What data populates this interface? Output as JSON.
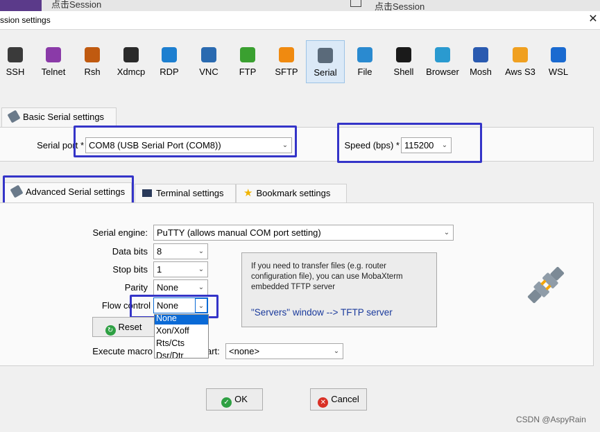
{
  "background": {
    "left_tab_label": "点击Session",
    "right_tab_label": "点击Session"
  },
  "window": {
    "title": "ssion settings",
    "close_glyph": "✕"
  },
  "toolbar": {
    "items": [
      {
        "label": "SSH",
        "icon": "key-icon",
        "color": "#3a3a3a"
      },
      {
        "label": "Telnet",
        "icon": "telnet-icon",
        "color": "#8a3aa8"
      },
      {
        "label": "Rsh",
        "icon": "rsh-icon",
        "color": "#c05a10"
      },
      {
        "label": "Xdmcp",
        "icon": "xdmcp-icon",
        "color": "#2a2a2a"
      },
      {
        "label": "RDP",
        "icon": "rdp-icon",
        "color": "#1d7fd0"
      },
      {
        "label": "VNC",
        "icon": "vnc-icon",
        "color": "#2a6ab0"
      },
      {
        "label": "FTP",
        "icon": "ftp-icon",
        "color": "#3aa030"
      },
      {
        "label": "SFTP",
        "icon": "sftp-icon",
        "color": "#f08a10"
      },
      {
        "label": "Serial",
        "icon": "serial-plug-icon",
        "color": "#5a6a7a",
        "selected": true
      },
      {
        "label": "File",
        "icon": "file-icon",
        "color": "#2a8ad0"
      },
      {
        "label": "Shell",
        "icon": "shell-icon",
        "color": "#1a1a1a"
      },
      {
        "label": "Browser",
        "icon": "globe-icon",
        "color": "#2a9ad0"
      },
      {
        "label": "Mosh",
        "icon": "mosh-icon",
        "color": "#2a5ab0"
      },
      {
        "label": "Aws S3",
        "icon": "aws-s3-icon",
        "color": "#f0a020"
      },
      {
        "label": "WSL",
        "icon": "wsl-icon",
        "color": "#1a6ad0"
      }
    ]
  },
  "basic": {
    "tab_label": "Basic Serial settings",
    "serial_port_label": "Serial port *",
    "serial_port_value": "COM8  (USB Serial Port (COM8))",
    "speed_label": "Speed (bps) *",
    "speed_value": "115200"
  },
  "advanced_tabs": {
    "advanced": "Advanced Serial settings",
    "terminal": "Terminal settings",
    "bookmark": "Bookmark settings"
  },
  "advanced": {
    "serial_engine_label": "Serial engine:",
    "serial_engine_value": "PuTTY    (allows manual COM port setting)",
    "data_bits_label": "Data bits",
    "data_bits_value": "8",
    "stop_bits_label": "Stop bits",
    "stop_bits_value": "1",
    "parity_label": "Parity",
    "parity_value": "None",
    "flow_control_label": "Flow control",
    "flow_control_value": "None",
    "flow_options": [
      "None",
      "Xon/Xoff",
      "Rts/Cts",
      "Dsr/Dtr"
    ],
    "reset_label": "Reset",
    "execute_macro_label": "Execute macro",
    "execute_macro_tail": "art:",
    "macro_value": "<none>",
    "info_text_1": "If you need to transfer files (e.g. router",
    "info_text_2": "configuration file), you can use MobaXterm",
    "info_text_3": "embedded TFTP server",
    "info_servers": "\"Servers\" window  -->  TFTP server"
  },
  "buttons": {
    "ok": "OK",
    "cancel": "Cancel"
  },
  "watermark": "CSDN @AspyRain",
  "colors": {
    "highlight": "#3434c8",
    "selection": "#0a6ad6",
    "ok_icon": "#2ea043",
    "cancel_icon": "#d93025"
  }
}
